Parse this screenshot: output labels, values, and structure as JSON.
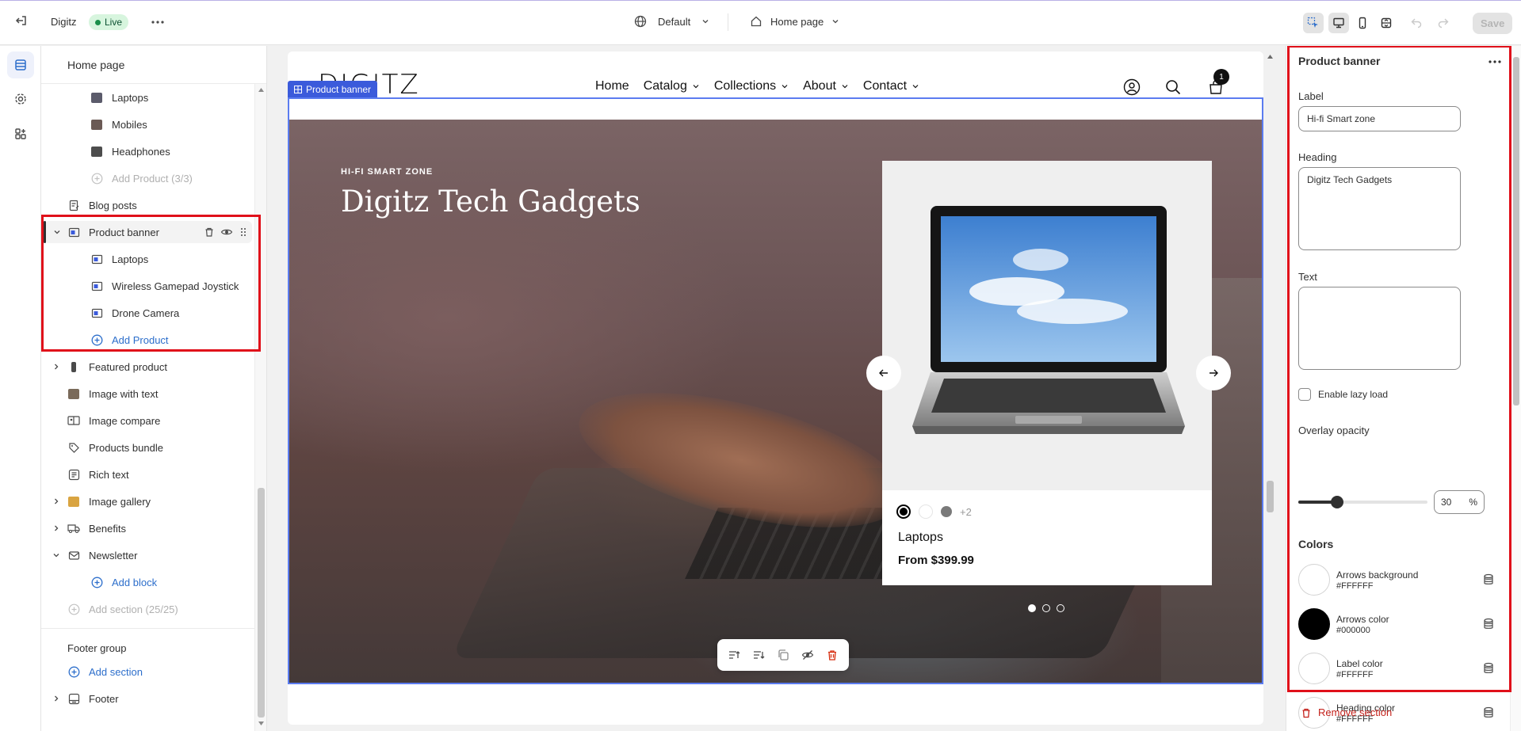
{
  "topbar": {
    "store_name": "Digitz",
    "status_badge": "Live",
    "theme_selector": "Default",
    "page_selector": "Home page",
    "save_label": "Save"
  },
  "sidebar": {
    "header": "Home page",
    "items": [
      {
        "label": "Laptops"
      },
      {
        "label": "Mobiles"
      },
      {
        "label": "Headphones"
      },
      {
        "label": "Add Product (3/3)"
      },
      {
        "label": "Blog posts"
      },
      {
        "label": "Product banner"
      },
      {
        "label": "Laptops"
      },
      {
        "label": "Wireless Gamepad Joystick"
      },
      {
        "label": "Drone Camera"
      },
      {
        "label": "Add Product"
      },
      {
        "label": "Featured product"
      },
      {
        "label": "Image with text"
      },
      {
        "label": "Image compare"
      },
      {
        "label": "Products bundle"
      },
      {
        "label": "Rich text"
      },
      {
        "label": "Image gallery"
      },
      {
        "label": "Benefits"
      },
      {
        "label": "Newsletter"
      },
      {
        "label": "Add block"
      },
      {
        "label": "Add section (25/25)"
      }
    ],
    "footer_group": {
      "title": "Footer group",
      "add_section": "Add section",
      "footer": "Footer"
    }
  },
  "preview": {
    "logo": "DIGITZ",
    "nav": [
      "Home",
      "Catalog",
      "Collections",
      "About",
      "Contact"
    ],
    "cart_count": "1",
    "section_tag": "Product banner",
    "kicker": "HI-FI SMART ZONE",
    "heading": "Digitz Tech Gadgets",
    "product": {
      "name": "Laptops",
      "price": "From $399.99",
      "swatches": [
        "#000000",
        "#ffffff",
        "#7a7a7a"
      ],
      "more_swatches": "+2"
    },
    "slide_count": 3,
    "active_slide": 1
  },
  "panel": {
    "title": "Product banner",
    "label_field": {
      "label": "Label",
      "value": "Hi-fi Smart zone"
    },
    "heading_field": {
      "label": "Heading",
      "value": "Digitz Tech Gadgets"
    },
    "text_field": {
      "label": "Text",
      "value": ""
    },
    "lazy_load": {
      "label": "Enable lazy load",
      "checked": false
    },
    "overlay": {
      "label": "Overlay opacity",
      "value": "30",
      "unit": "%",
      "percent": 30
    },
    "colors_title": "Colors",
    "colors": [
      {
        "name": "Arrows background",
        "hex": "#FFFFFF"
      },
      {
        "name": "Arrows color",
        "hex": "#000000"
      },
      {
        "name": "Label color",
        "hex": "#FFFFFF"
      },
      {
        "name": "Heading color",
        "hex": "#FFFFFF"
      }
    ],
    "remove_label": "Remove section"
  },
  "theme": {
    "accent": "#2c6ecb",
    "highlight": "#e0101a",
    "selection": "#5b7cf0"
  }
}
